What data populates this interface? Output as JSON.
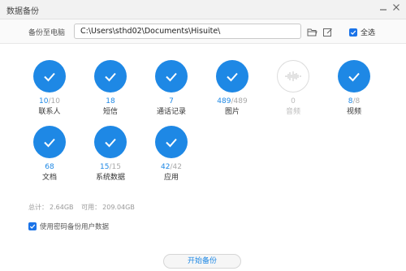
{
  "window": {
    "title": "数据备份",
    "minimize_icon": "minimize-icon",
    "close_icon": "close-icon"
  },
  "path": {
    "label": "备份至电脑",
    "value": "C:\\Users\\sthd02\\Documents\\Hisuite\\",
    "folder_icon": "folder-open-icon",
    "edit_icon": "edit-icon",
    "select_all_label": "全选",
    "select_all_checked": true
  },
  "items": [
    {
      "label": "联系人",
      "done": "10",
      "total": "10",
      "enabled": true
    },
    {
      "label": "短信",
      "done": "18",
      "total": "",
      "enabled": true
    },
    {
      "label": "通话记录",
      "done": "7",
      "total": "",
      "enabled": true
    },
    {
      "label": "图片",
      "done": "489",
      "total": "489",
      "enabled": true
    },
    {
      "label": "音频",
      "done": "0",
      "total": "",
      "enabled": false
    },
    {
      "label": "视频",
      "done": "8",
      "total": "8",
      "enabled": true
    },
    {
      "label": "文档",
      "done": "68",
      "total": "",
      "enabled": true
    },
    {
      "label": "系统数据",
      "done": "15",
      "total": "15",
      "enabled": true
    },
    {
      "label": "应用",
      "done": "42",
      "total": "42",
      "enabled": true
    }
  ],
  "sizes": {
    "total_label": "总计：",
    "total_value": "2.64GB",
    "avail_label": "可用：",
    "avail_value": "209.04GB"
  },
  "password": {
    "label": "使用密码备份用户数据",
    "checked": true
  },
  "start_button": "开始备份",
  "colors": {
    "accent": "#1e88e5",
    "disabled": "#dcdcdc"
  }
}
